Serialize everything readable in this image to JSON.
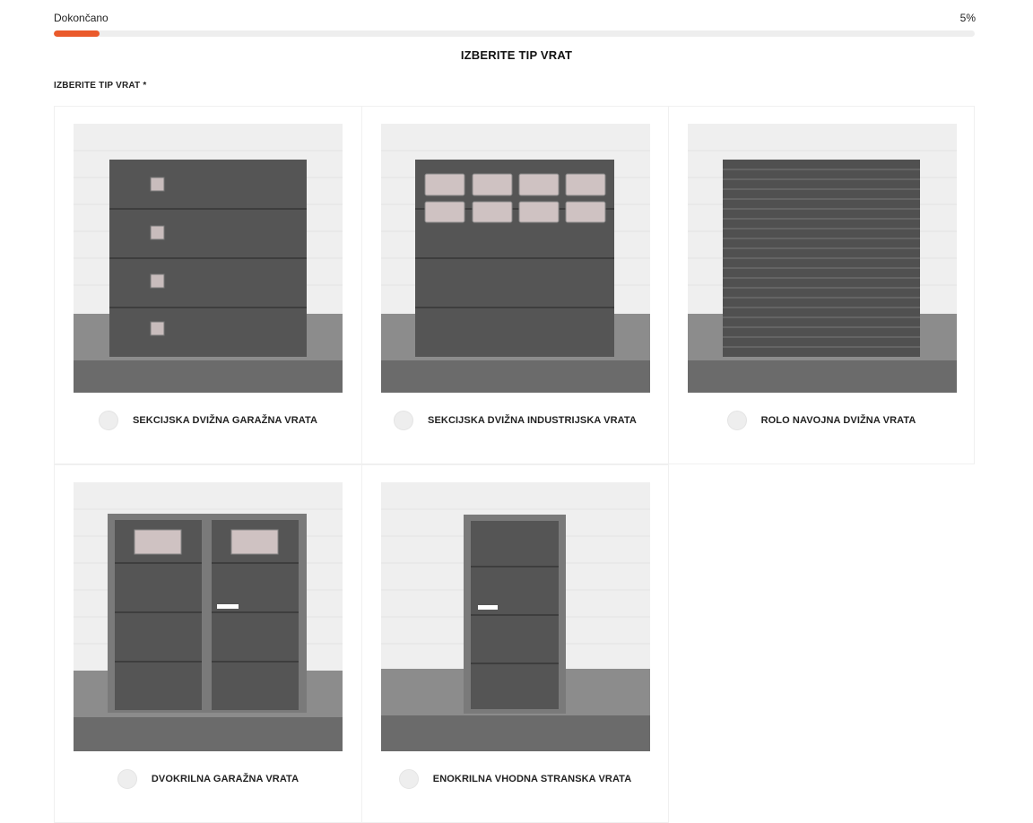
{
  "progress": {
    "label": "Dokončano",
    "value_text": "5%",
    "fraction": 0.05,
    "accent_color": "#ea5a2b"
  },
  "section": {
    "title": "IZBERITE TIP VRAT"
  },
  "field": {
    "label": "IZBERITE TIP VRAT *"
  },
  "options": [
    {
      "label": "SEKCIJSKA DVIŽNA GARAŽNA VRATA",
      "image_icon": "sectional-garage-door-image"
    },
    {
      "label": "SEKCIJSKA DVIŽNA INDUSTRIJSKA VRATA",
      "image_icon": "sectional-industrial-door-image"
    },
    {
      "label": "ROLO NAVOJNA DVIŽNA VRATA",
      "image_icon": "roller-door-image"
    },
    {
      "label": "DVOKRILNA GARAŽNA VRATA",
      "image_icon": "double-wing-garage-door-image"
    },
    {
      "label": "ENOKRILNA VHODNA STRANSKA VRATA",
      "image_icon": "single-wing-side-door-image"
    }
  ]
}
